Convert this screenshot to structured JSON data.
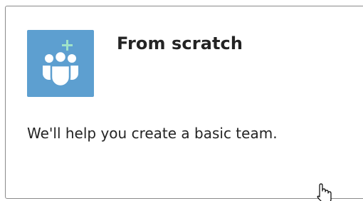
{
  "card": {
    "icon": "team-add-icon",
    "accent_color": "#5d9fd0",
    "plus_color": "#9fe3c9",
    "title": "From scratch",
    "description": "We'll help you create a basic team."
  },
  "cursor": {
    "icon": "hand-pointer-icon"
  }
}
